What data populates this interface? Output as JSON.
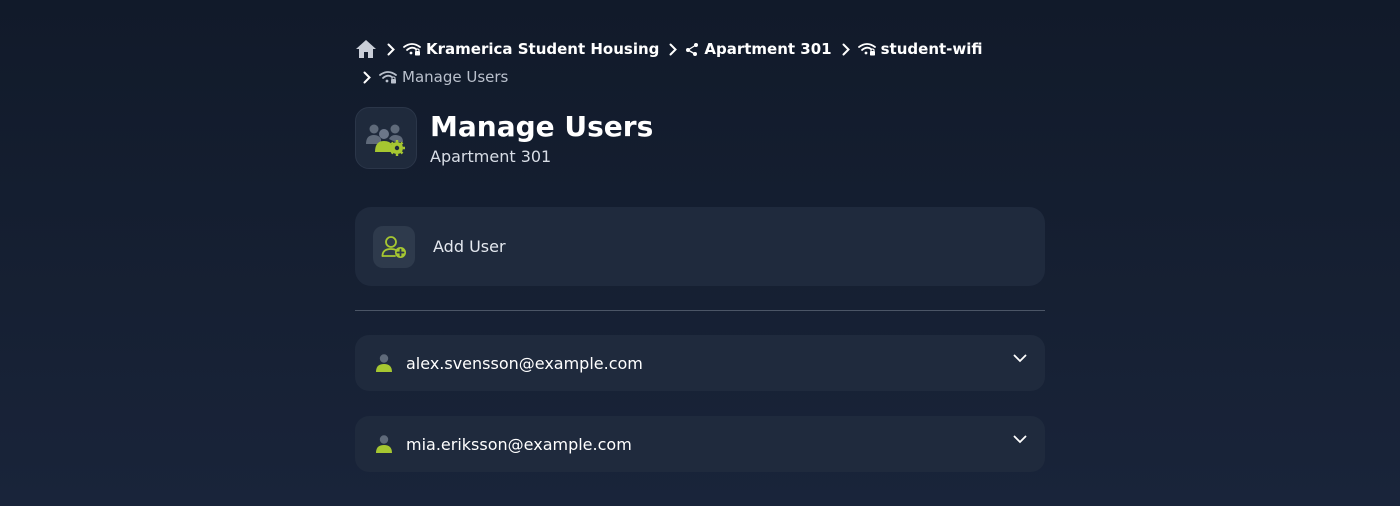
{
  "breadcrumb": {
    "items": [
      {
        "label": "",
        "icon": "home-icon"
      },
      {
        "label": "Kramerica Student Housing",
        "icon": "wifi-lock-icon"
      },
      {
        "label": "Apartment 301",
        "icon": "network-nodes-icon"
      },
      {
        "label": "student-wifi",
        "icon": "wifi-lock-icon"
      },
      {
        "label": "Manage Users",
        "icon": "wifi-lock-icon"
      }
    ]
  },
  "header": {
    "title": "Manage Users",
    "subtitle": "Apartment 301",
    "icon": "users-gear-icon"
  },
  "add_user": {
    "label": "Add User",
    "icon": "user-add-icon"
  },
  "users": [
    {
      "email": "alex.svensson@example.com",
      "icon": "user-icon"
    },
    {
      "email": "mia.eriksson@example.com",
      "icon": "user-icon"
    }
  ],
  "colors": {
    "accent": "#a6c731",
    "background": "#131c2c",
    "card": "#1f2a3d"
  }
}
